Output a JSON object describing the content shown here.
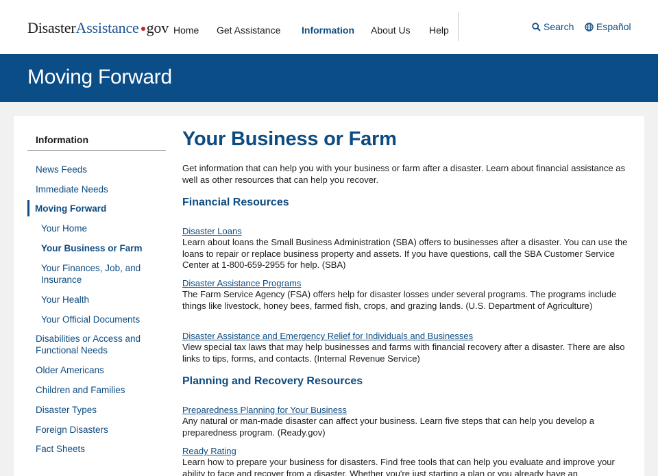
{
  "header": {
    "logo": {
      "part1": "Disaster",
      "part2": "Assistance",
      "part3": "gov"
    },
    "nav": [
      {
        "label": "Home"
      },
      {
        "label": "Get Assistance"
      },
      {
        "label": "Information"
      },
      {
        "label": "About Us"
      },
      {
        "label": "Help"
      }
    ],
    "search_label": "Search",
    "language_label": "Español"
  },
  "banner": {
    "title": "Moving Forward"
  },
  "sidebar": {
    "heading": "Information",
    "items": [
      {
        "label": "News Feeds"
      },
      {
        "label": "Immediate Needs"
      },
      {
        "label": "Moving Forward"
      },
      {
        "label": "Your Home"
      },
      {
        "label": "Your Business or Farm"
      },
      {
        "label": "Your Finances, Job, and Insurance"
      },
      {
        "label": "Your Health"
      },
      {
        "label": "Your Official Documents"
      },
      {
        "label": "Disabilities or Access and Functional Needs"
      },
      {
        "label": "Older Americans"
      },
      {
        "label": "Children and Families"
      },
      {
        "label": "Disaster Types"
      },
      {
        "label": "Foreign Disasters"
      },
      {
        "label": "Fact Sheets"
      }
    ]
  },
  "main": {
    "title": "Your Business or Farm",
    "intro": "Get information that can help you with your business or farm after a disaster. Learn about financial assistance as well as other resources that can help you recover.",
    "sections": [
      {
        "title": "Financial Resources",
        "resources": [
          {
            "link": "Disaster Loans",
            "description": "Learn about loans the Small Business Administration (SBA) offers to businesses after a disaster. You can use the loans to repair or replace business property and assets. If you have questions, call the SBA Customer Service Center at 1-800-659-2955 for help. (SBA)"
          },
          {
            "link": "Disaster Assistance Programs",
            "description": "The Farm Service Agency (FSA) offers help for disaster losses under several programs. The programs include things like livestock, honey bees, farmed fish, crops, and grazing lands. (U.S. Department of Agriculture)"
          },
          {
            "link": "Disaster Assistance and Emergency Relief for Individuals and Businesses",
            "description": "View special tax laws that may help businesses and farms with financial recovery after a disaster. There are also links to tips, forms, and contacts. (Internal Revenue Service)"
          }
        ]
      },
      {
        "title": "Planning and Recovery Resources",
        "resources": [
          {
            "link": "Preparedness Planning for Your Business",
            "description": "Any natural or man-made disaster can affect your business. Learn five steps that can help you develop a preparedness program. (Ready.gov)"
          },
          {
            "link": "Ready Rating",
            "description": "Learn how to prepare your business for disasters. Find free tools that can help you evaluate and improve your ability to face and recover from a disaster. Whether you're just starting a plan or you already have an"
          }
        ]
      }
    ]
  },
  "colors": {
    "brand_blue": "#0b4d87",
    "link_blue": "#0d4b80",
    "logo_dot": "#c0272d"
  }
}
